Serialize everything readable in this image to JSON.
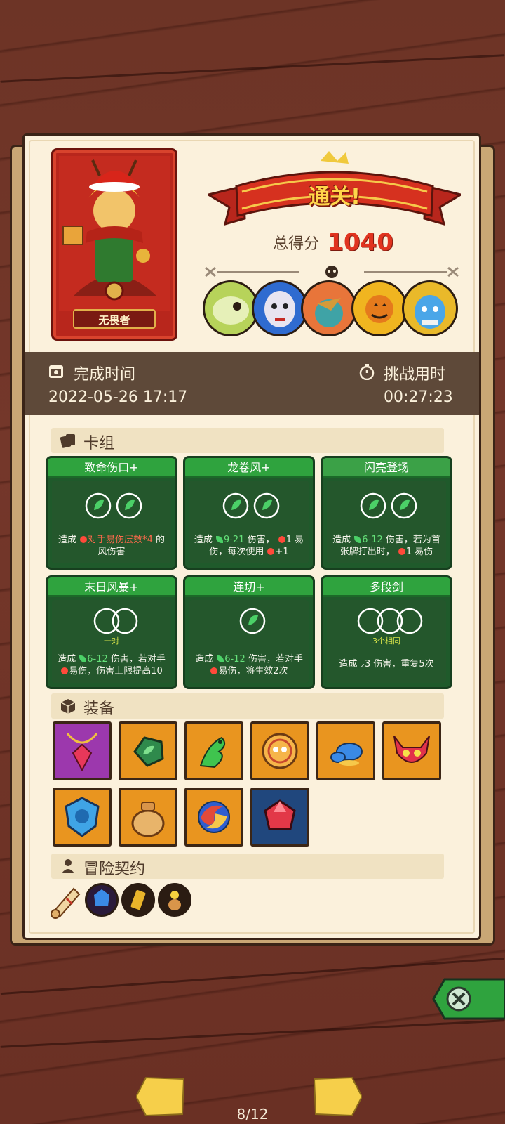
{
  "result": {
    "banner": "通关!",
    "score_label": "总得分",
    "score_value": "1040"
  },
  "hero": {
    "name": "无畏者"
  },
  "bosses": [
    "lizard-skull-boss",
    "masked-face-boss",
    "bird-rider-boss",
    "pumpkin-sun-boss",
    "blue-demon-boss"
  ],
  "time": {
    "finish_label": "完成时间",
    "finish_value": "2022-05-26 17:17",
    "duration_label": "挑战用时",
    "duration_value": "00:27:23"
  },
  "sections": {
    "deck": "卡组",
    "equipment": "装备",
    "contract": "冒险契约"
  },
  "cards": [
    {
      "title": "致命伤口+",
      "desc_a": "造成 ",
      "desc_red": "对手易伤层数*4",
      "desc_b": " 的风伤害",
      "slots": 2
    },
    {
      "title": "龙卷风+",
      "desc_a": "造成 ",
      "desc_green": "9-21",
      "desc_b": " 伤害， ",
      "desc_red": "1",
      "desc_c": " 易伤，每次使用 ",
      "desc_d": "+1",
      "slots": 2
    },
    {
      "title": "闪亮登场",
      "desc_a": "造成 ",
      "desc_green": "6-12",
      "desc_b": " 伤害，若为首张牌打出时， ",
      "desc_red": "1",
      "desc_c": " 易伤",
      "slots": 2
    },
    {
      "title": "末日风暴+",
      "sub": "一对",
      "desc_a": "造成 ",
      "desc_green": "6-12",
      "desc_b": " 伤害，若对手 ",
      "desc_c": "易伤，伤害上限提高10",
      "slots": 2
    },
    {
      "title": "连切+",
      "desc_a": "造成 ",
      "desc_green": "6-12",
      "desc_b": " 伤害，若对手 ",
      "desc_c": "易伤，将生效2次",
      "slots": 1
    },
    {
      "title": "多段剑",
      "sub": "3个相同",
      "desc_a": "造成 ",
      "desc_b": "3 伤害，重复5次",
      "slots": 3
    }
  ],
  "equipment": [
    {
      "name": "ruby-necklace-icon",
      "color": "#9c38ad"
    },
    {
      "name": "green-stone-icon",
      "color": "#e9951f"
    },
    {
      "name": "green-dragon-icon",
      "color": "#e9951f"
    },
    {
      "name": "orange-coin-icon",
      "color": "#e9951f"
    },
    {
      "name": "blue-slime-icon",
      "color": "#e9951f"
    },
    {
      "name": "red-demon-mask-icon",
      "color": "#e9951f"
    },
    {
      "name": "blue-crest-shield-icon",
      "color": "#e9951f"
    },
    {
      "name": "coin-sack-icon",
      "color": "#e9951f"
    },
    {
      "name": "swirl-orb-icon",
      "color": "#e9951f"
    },
    {
      "name": "red-gem-icon",
      "color": "#20477d"
    }
  ],
  "contracts": [
    "scroll-icon",
    "blue-crystal-icon",
    "golden-tag-icon",
    "flower-vase-icon"
  ],
  "pagination": {
    "current": "8/12"
  },
  "colors": {
    "panel": "#fbf1dc",
    "band": "#5e4939",
    "card_green": "#1f5a2b",
    "score_red": "#e0331f",
    "banner_gold": "#ffd64a"
  }
}
